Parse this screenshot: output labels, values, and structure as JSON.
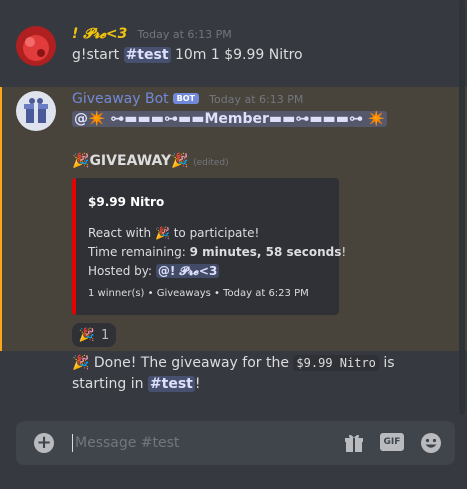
{
  "messages": [
    {
      "username": "! 𝓟𝓻𝓮<3",
      "timestamp": "Today at 6:13 PM",
      "text_before": "g!start ",
      "channel_mention": "#test",
      "text_after": " 10m 1 $9.99 Nitro"
    },
    {
      "username": "Giveaway Bot",
      "bot_tag": "BOT",
      "timestamp": "Today at 6:13 PM",
      "role_mention": "@✴️ ⊶▬▬▬⊶▬▬Member▬▬⊶▬▬▬⊶ ✴️",
      "giveaway_title": "GIVEAWAY",
      "edited_label": "(edited)",
      "embed": {
        "title": "$9.99 Nitro",
        "react_text_before": "React with ",
        "react_text_after": " to participate!",
        "time_label": "Time remaining: ",
        "time_value": "9 minutes, 58 seconds",
        "time_suffix": "!",
        "hosted_label": "Hosted by: ",
        "host_mention": "@! 𝓟𝓻𝓮<3",
        "footer": "1 winner(s) • Giveaways • Today at 6:23 PM"
      },
      "reaction_count": "1"
    },
    {
      "text_before": " Done! The giveaway for the ",
      "code": "$9.99 Nitro",
      "text_middle": " is",
      "line2_before": "starting in ",
      "channel_mention": "#test",
      "line2_after": "!"
    }
  ],
  "composer": {
    "placeholder": "Message #test",
    "gif_label": "GIF",
    "add_label": "+"
  },
  "colors": {
    "username1": "#f1c40f",
    "bot_name": "#7289da",
    "embed_bar": "#e60000",
    "highlight": "#faa61a"
  }
}
